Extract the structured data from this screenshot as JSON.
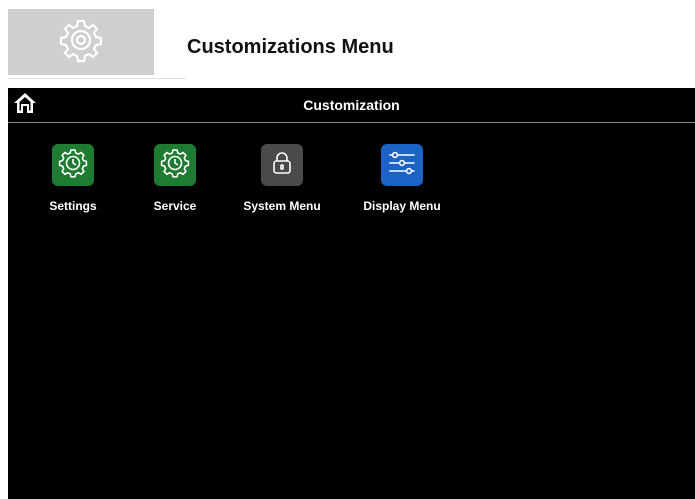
{
  "header": {
    "title": "Customizations Menu",
    "logo_icon": "gear-icon",
    "logo_bg": "#cfcfcf"
  },
  "screen": {
    "title": "Customization",
    "home_icon": "home-icon",
    "items": [
      {
        "label": "Settings",
        "icon": "gear-clock-icon",
        "color": "#1e7b32"
      },
      {
        "label": "Service",
        "icon": "gear-clock-icon",
        "color": "#1e7b32"
      },
      {
        "label": "System Menu",
        "icon": "lock-icon",
        "color": "#4a4a4a"
      },
      {
        "label": "Display Menu",
        "icon": "sliders-icon",
        "color": "#1b63c4"
      }
    ]
  }
}
